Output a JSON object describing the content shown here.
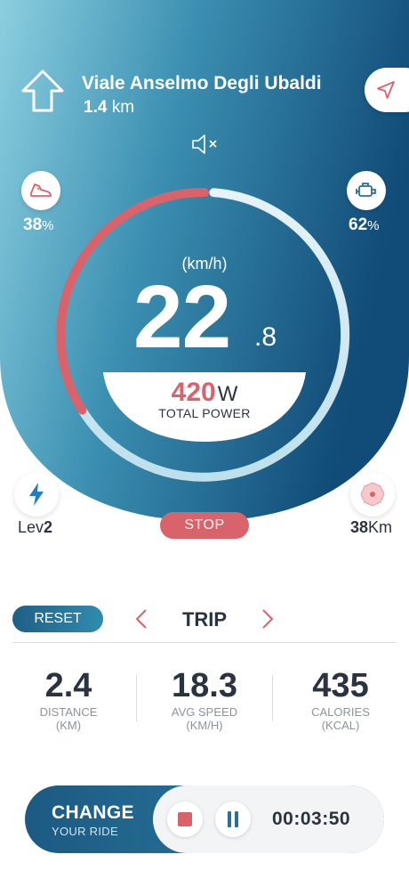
{
  "navigation": {
    "street": "Viale Anselmo Degli Ubaldi",
    "distance_value": "1.4",
    "distance_unit": "km"
  },
  "left_gauge": {
    "value": "38",
    "unit": "%",
    "icon": "sneaker-icon",
    "level": 0.38
  },
  "right_gauge": {
    "value": "62",
    "unit": "%",
    "icon": "engine-icon",
    "level": 0.62
  },
  "speedometer": {
    "unit_label": "(km/h)",
    "speed_integer": "22",
    "speed_decimal": ".8",
    "power_value": "420",
    "power_unit": "W",
    "power_label": "TOTAL POWER"
  },
  "controls": {
    "stop_label": "STOP",
    "assist_prefix": "Lev",
    "assist_level": "2",
    "range_value": "38",
    "range_unit": "Km"
  },
  "trip": {
    "reset_label": "RESET",
    "title": "TRIP",
    "stats": [
      {
        "value": "2.4",
        "label": "DISTANCE",
        "unit": "(KM)"
      },
      {
        "value": "18.3",
        "label": "AVG SPEED",
        "unit": "(KM/H)"
      },
      {
        "value": "435",
        "label": "CALORIES",
        "unit": "(KCAL)"
      }
    ]
  },
  "bottom": {
    "change_label": "CHANGE",
    "change_sub": "YOUR RIDE",
    "timer": "00:03:50"
  },
  "colors": {
    "accent_red": "#d9636b",
    "deep_blue": "#1c5a82",
    "light_blue": "#8ccfe0"
  }
}
